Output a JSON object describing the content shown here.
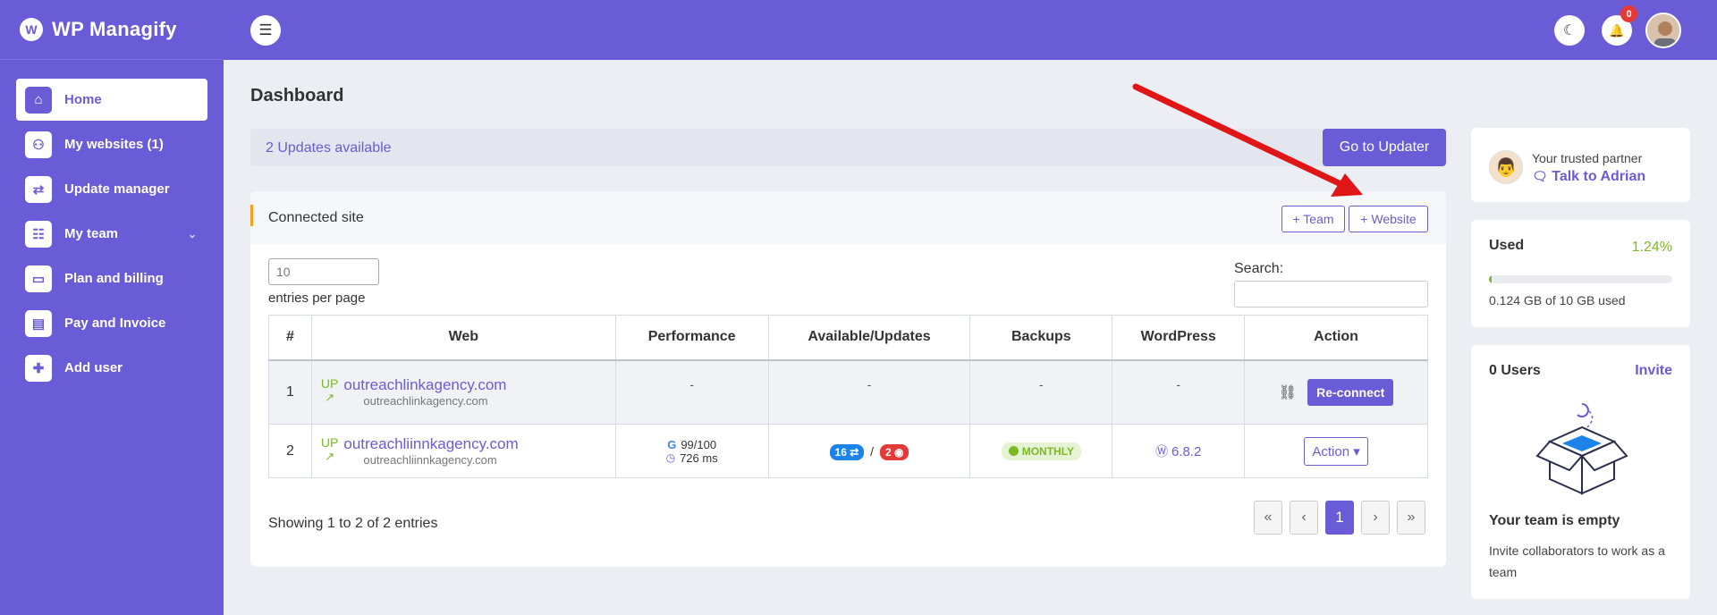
{
  "brand": {
    "name": "WP Managify",
    "logo_letter": "W"
  },
  "sidebar": {
    "items": [
      {
        "label": "Home",
        "icon": "home-icon",
        "glyph": "⌂",
        "active": true
      },
      {
        "label": "My websites (1)",
        "icon": "sitemap-icon",
        "glyph": "⚇"
      },
      {
        "label": "Update manager",
        "icon": "exchange-icon",
        "glyph": "⇄"
      },
      {
        "label": "My team",
        "icon": "users-icon",
        "glyph": "☷",
        "chevron": "⌄"
      },
      {
        "label": "Plan and billing",
        "icon": "credit-card-icon",
        "glyph": "▭"
      },
      {
        "label": "Pay and Invoice",
        "icon": "invoice-icon",
        "glyph": "▤"
      },
      {
        "label": "Add user",
        "icon": "add-user-icon",
        "glyph": "✚"
      }
    ]
  },
  "topbar": {
    "menu_glyph": "☰",
    "theme_glyph": "☾",
    "bell_glyph": "🔔",
    "notifications_count": "0"
  },
  "page": {
    "title": "Dashboard"
  },
  "updates": {
    "text": "2 Updates available",
    "button": "Go to Updater"
  },
  "connected": {
    "title": "Connected site",
    "team_btn": "+ Team",
    "website_btn": "+ Website",
    "per_page_placeholder": "10",
    "per_page_label": "entries per page",
    "search_label": "Search:",
    "columns": [
      "#",
      "Web",
      "Performance",
      "Available/Updates",
      "Backups",
      "WordPress",
      "Action"
    ],
    "rows": [
      {
        "num": "1",
        "status": "UP",
        "trend": "↗",
        "site": "outreachlinkagency.com",
        "site_sub": "outreachlinkagency.com",
        "performance": "-",
        "updates": "-",
        "backups": "-",
        "wordpress": "-",
        "unlink_glyph": "⛓",
        "action": "Re-connect"
      },
      {
        "num": "2",
        "status": "UP",
        "trend": "↗",
        "site": "outreachliinnkagency.com",
        "site_sub": "outreachliinnkagency.com",
        "perf_score": "99/100",
        "perf_time": "726 ms",
        "g_glyph": "G",
        "clock_glyph": "◷",
        "updates_available": "16 ⇄",
        "separator": "/",
        "updates_pending": "2 ◉",
        "backups": "MONTHLY",
        "wp_glyph": "Ⓦ",
        "wordpress": "6.8.2",
        "action": "Action ▾"
      }
    ],
    "showing": "Showing 1 to 2 of 2 entries",
    "pagination": [
      "«",
      "‹",
      "1",
      "›",
      "»"
    ]
  },
  "partner": {
    "label": "Your trusted partner",
    "link": "Talk to Adrian",
    "chat_glyph": "🗨",
    "avatar_glyph": "👨"
  },
  "usage": {
    "label": "Used",
    "percent": "1.24%",
    "fraction": 0.0124,
    "detail": "0.124 GB of 10 GB used"
  },
  "team": {
    "count": "0 Users",
    "invite": "Invite",
    "empty_title": "Your team is empty",
    "empty_desc": "Invite collaborators to work as a team"
  },
  "colors": {
    "primary": "#6a5bd6",
    "success": "#7cb826",
    "danger": "#e53935",
    "accent": "#f4a11e"
  }
}
